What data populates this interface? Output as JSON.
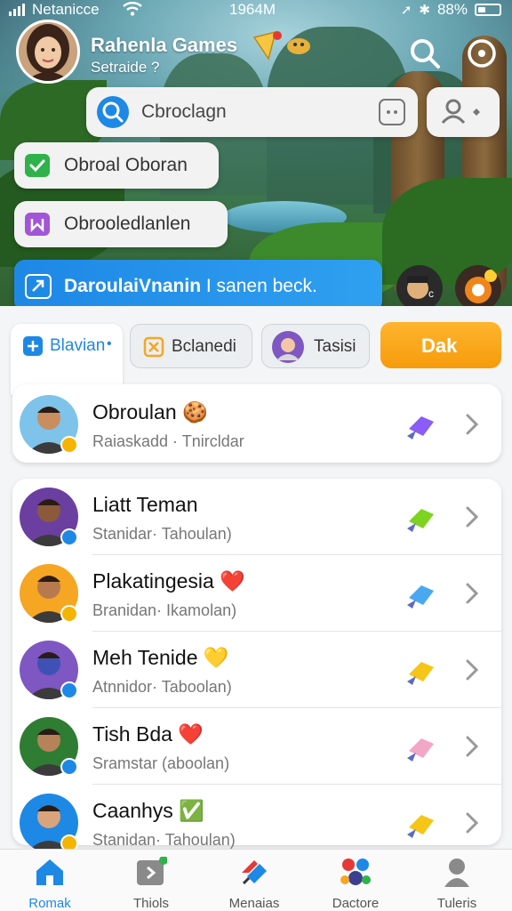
{
  "status_bar": {
    "carrier": "Netanicce",
    "time": "1964M",
    "battery": "88%"
  },
  "header": {
    "title": "Rahenla Games",
    "subtitle": "Setraide ?"
  },
  "search": {
    "text": "Cbroclagn"
  },
  "chips": [
    {
      "label": "Obroal Oboran",
      "icon": "check-icon",
      "color": "#2fb24a"
    },
    {
      "label": "Obrooledlanlen",
      "icon": "stream-icon",
      "color": "#a255d6"
    }
  ],
  "banner": {
    "bold": "DaroulaiVnanin",
    "rest": " I sanen beck."
  },
  "tabs": [
    {
      "label": "Blavian",
      "icon": "plus-icon"
    },
    {
      "label": "Bclanedi",
      "icon": "box-icon"
    },
    {
      "label": "Tasisi",
      "icon": "avatar"
    },
    {
      "label": "Dak"
    }
  ],
  "items": [
    {
      "name": "Obroulan",
      "sub": "Raiaskadd · Tnircldar",
      "emoji": "🍪",
      "dot": "#f5b400",
      "gem_color": "#8b5cf6"
    },
    {
      "name": "Liatt Teman",
      "sub": "Stanidar· Tahoulan)",
      "emoji": "",
      "dot": "#1e88e5",
      "gem_color": "#7ed321"
    },
    {
      "name": "Plakatingesia",
      "sub": "Branidan· Ikamolan)",
      "emoji": "❤️",
      "dot": "#f5b400",
      "gem_color": "#4aa8f0"
    },
    {
      "name": "Meh Tenide",
      "sub": "Atnnidor· Taboolan)",
      "emoji": "💛",
      "dot": "#1e88e5",
      "gem_color": "#f5c518"
    },
    {
      "name": "Tish Bda",
      "sub": "Sramstar (aboolan)",
      "emoji": "❤️",
      "dot": "#1e88e5",
      "gem_color": "#f2a7c7"
    },
    {
      "name": "Caanhys",
      "sub": "Stanidan· Tahoulan)",
      "emoji": "✅",
      "dot": "#f5b400",
      "gem_color": "#f5c518"
    }
  ],
  "nav": [
    {
      "label": "Romak",
      "icon": "home-icon",
      "active": true
    },
    {
      "label": "Thiols",
      "icon": "play-icon"
    },
    {
      "label": "Menaias",
      "icon": "share-icon"
    },
    {
      "label": "Dactore",
      "icon": "puzzle-icon"
    },
    {
      "label": "Tuleris",
      "icon": "user-icon"
    }
  ]
}
